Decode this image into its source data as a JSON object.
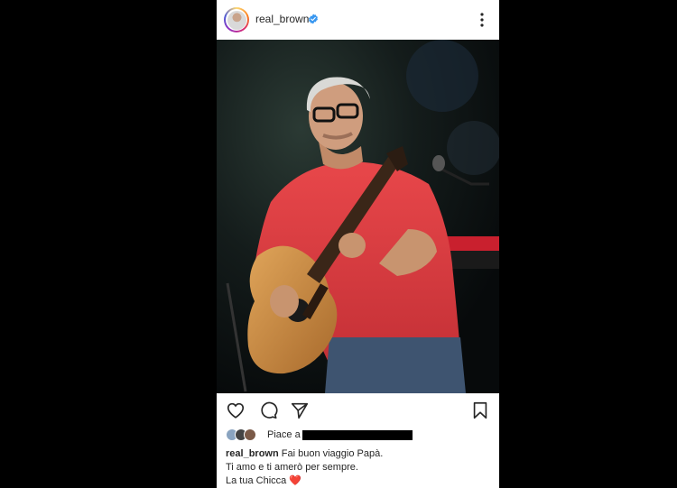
{
  "post": {
    "username": "real_brown",
    "verified_icon": "verified-badge-icon",
    "more_icon": "more-options-icon",
    "photo_description_icon": "photo",
    "actions": {
      "like_icon": "heart-icon",
      "comment_icon": "comment-icon",
      "share_icon": "send-icon",
      "save_icon": "bookmark-icon"
    },
    "likes_prefix": "Piace a",
    "caption": {
      "username": "real_brown",
      "line1": "Fai buon viaggio Papà.",
      "line2": "Ti amo e ti amerò per sempre.",
      "line3": "La tua Chicca",
      "emoji": "❤️"
    }
  },
  "colors": {
    "background": "#000000",
    "card": "#ffffff",
    "text": "#262626",
    "verified": "#3897f0",
    "shirt": "#e23a3f"
  }
}
